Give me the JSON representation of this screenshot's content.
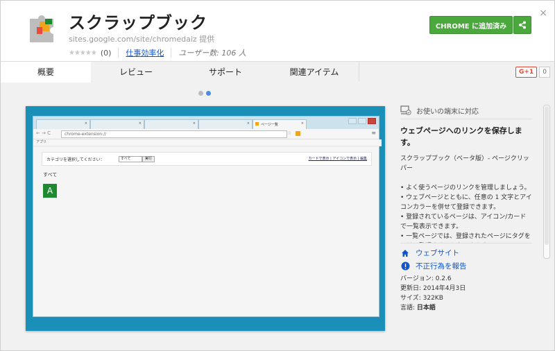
{
  "app": {
    "title": "スクラップブック",
    "offered_by": "sites.google.com/site/chromedaiz 提供",
    "rating_count": "(0)",
    "category": "仕事効率化",
    "users": "ユーザー数: 106 人",
    "add_button": "CHROME に追加済み",
    "close": "×"
  },
  "tabs": [
    "概要",
    "レビュー",
    "サポート",
    "関連アイテム"
  ],
  "gplus": {
    "label": "G+1",
    "count": "0"
  },
  "carousel": {
    "dots": 2,
    "active": 1
  },
  "screenshot": {
    "tab_title": "ページ一覧",
    "url": "chrome-extension://",
    "bookmarks": "アプリ",
    "category_prompt": "カテゴリを選択してください：",
    "select_value": "すべて",
    "exec_label": "実行",
    "view_links": "カードで表示 | アイコンで表示 | 編集",
    "all_label": "すべて",
    "tile_letter": "A"
  },
  "sidebar": {
    "compat": "お使いの端末に対応",
    "headline": "ウェブページへのリンクを保存します。",
    "description": "スクラップブック（ベータ版）- ページクリッパー\n\n• よく使うページのリンクを管理しましょう。\n• ウェブページとともに、任意の 1 文字とアイコンカラーを併せて登録できます。\n• 登録されているページは、アイコン/カードで一覧表示できます。\n• 一覧ページでは、登録されたページにタグをつけて整理することもできます。\n• 登録されているページデータは、タグごと",
    "website_link": "ウェブサイト",
    "report_link": "不正行為を報告",
    "version": "バージョン: 0.2.6",
    "updated": "更新日: 2014年4月3日",
    "size": "サイズ: 322KB",
    "language_label": "言語: ",
    "language": "日本語"
  },
  "colors": {
    "accent_green": "#4aa83c",
    "link": "#1155cc",
    "screenshot_bg": "#1a8fb8"
  }
}
